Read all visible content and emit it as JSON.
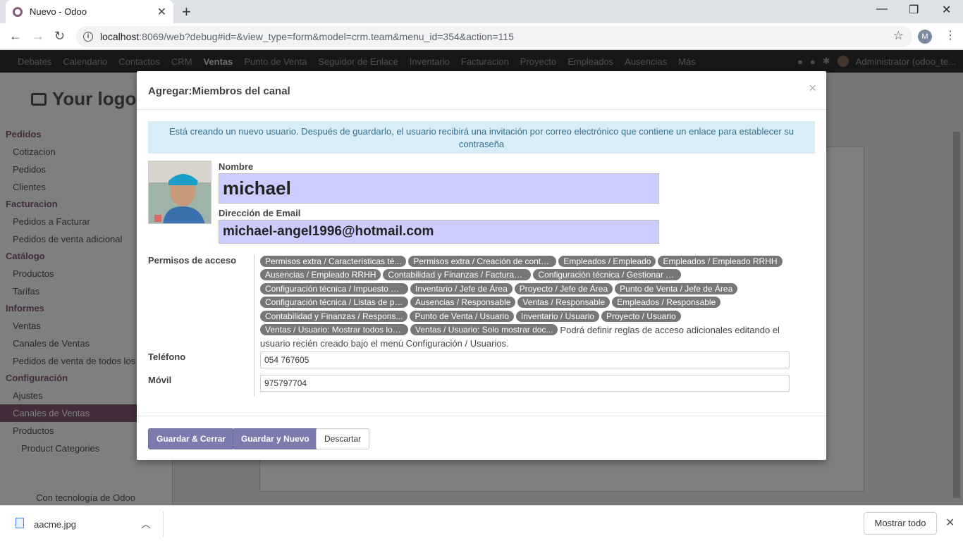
{
  "browser": {
    "tab_title": "Nuevo - Odoo",
    "url_host": "localhost",
    "url_rest": ":8069/web?debug#id=&view_type=form&model=crm.team&menu_id=354&action=115",
    "profile_initial": "M"
  },
  "odoo_nav": {
    "items": [
      "Debates",
      "Calendario",
      "Contactos",
      "CRM",
      "Ventas",
      "Punto de Venta",
      "Seguidor de Enlace",
      "Inventario",
      "Facturacion",
      "Proyecto",
      "Empleados",
      "Ausencias",
      "Más"
    ],
    "active": "Ventas",
    "user": "Administrator (odoo_te..."
  },
  "sidebar": {
    "logo": "Your logo",
    "groups": [
      {
        "title": "Pedidos",
        "items": [
          "Cotizacion",
          "Pedidos",
          "Clientes"
        ]
      },
      {
        "title": "Facturacion",
        "items": [
          "Pedidos a Facturar",
          "Pedidos de venta adicional"
        ]
      },
      {
        "title": "Catálogo",
        "items": [
          "Productos",
          "Tarifas"
        ]
      },
      {
        "title": "Informes",
        "items": [
          "Ventas",
          "Canales de Ventas",
          "Pedidos de venta de todos los"
        ]
      },
      {
        "title": "Configuración",
        "items": [
          "Ajustes",
          "Canales de Ventas"
        ]
      }
    ],
    "selected": "Canales de Ventas",
    "products_group": "Productos",
    "product_categories": "Product Categories",
    "powered_by": "Con tecnología de Odoo"
  },
  "modal": {
    "title": "Agregar:Miembros del canal",
    "alert": "Está creando un nuevo usuario. Después de guardarlo, el usuario recibirá una invitación por correo electrónico que contiene un enlace para establecer su contraseña",
    "name_label": "Nombre",
    "name_value": "michael",
    "email_label": "Dirección de Email",
    "email_value": "michael-angel1996@hotmail.com",
    "perms_label": "Permisos de acceso",
    "perm_tags": [
      "Permisos extra / Características té...",
      "Permisos extra / Creación de conta...",
      "Empleados / Empleado",
      "Empleados / Empleado RRHH",
      "Ausencias / Empleado RRHH",
      "Contabilidad y Finanzas / Facturaci...",
      "Configuración técnica / Gestionar e...",
      "Configuración técnica / Impuesto B...",
      "Inventario / Jefe de Área",
      "Proyecto / Jefe de Área",
      "Punto de Venta / Jefe de Área",
      "Configuración técnica / Listas de pr...",
      "Ausencias / Responsable",
      "Ventas / Responsable",
      "Empleados / Responsable",
      "Contabilidad y Finanzas / Respons...",
      "Punto de Venta / Usuario",
      "Inventario / Usuario",
      "Proyecto / Usuario",
      "Ventas / Usuario: Mostrar todos los...",
      "Ventas / Usuario: Solo mostrar doc..."
    ],
    "perms_note": "Podrá definir reglas de acceso adicionales editando el usuario recién creado bajo el menú Configuración / Usuarios.",
    "phone_label": "Teléfono",
    "phone_value": "054 767605",
    "mobile_label": "Móvil",
    "mobile_value": "975797704",
    "save_close": "Guardar & Cerrar",
    "save_new": "Guardar y Nuevo",
    "discard": "Descartar"
  },
  "downloads": {
    "file": "aacme.jpg",
    "show_all": "Mostrar todo"
  }
}
